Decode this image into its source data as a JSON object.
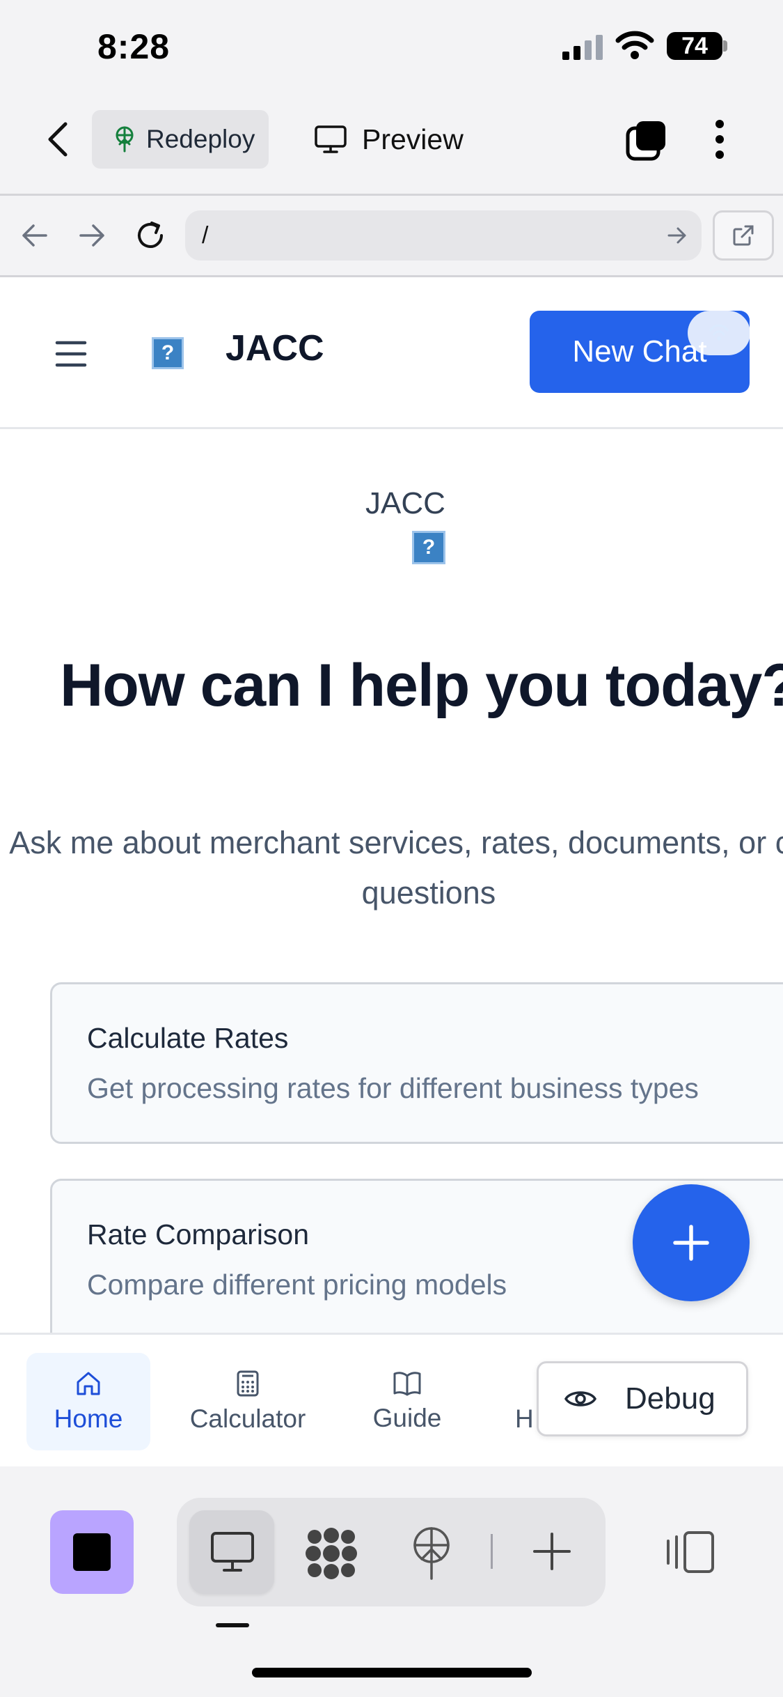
{
  "status_bar": {
    "time": "8:28",
    "battery": "74"
  },
  "top_bar": {
    "redeploy_label": "Redeploy",
    "preview_label": "Preview"
  },
  "url_bar": {
    "url": "/"
  },
  "app": {
    "brand": "JACC",
    "new_chat_label": "New Chat",
    "hero_logo_text": "JACC",
    "logo_icon_glyph": "?",
    "hero_title": "How can I help you today?",
    "hero_subtitle": "Ask me about merchant services, rates, documents, or client questions",
    "cards": [
      {
        "title": "Calculate Rates",
        "description": "Get processing rates for different business types"
      },
      {
        "title": "Rate Comparison",
        "description": "Compare different pricing models"
      }
    ]
  },
  "bottom_nav": {
    "items": [
      {
        "label": "Home",
        "icon": "home-icon"
      },
      {
        "label": "Calculator",
        "icon": "calculator-icon"
      },
      {
        "label": "Guide",
        "icon": "book-icon"
      },
      {
        "label": "H",
        "icon": ""
      }
    ],
    "debug_label": "Debug"
  },
  "colors": {
    "accent": "#2563eb",
    "stop_button": "#b9a4ff",
    "home_active_bg": "#eff6ff"
  }
}
